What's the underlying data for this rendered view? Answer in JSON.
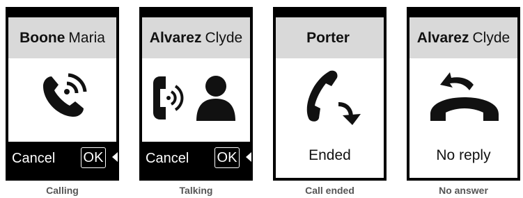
{
  "screens": [
    {
      "last_name": "Boone",
      "first_name": "Maria",
      "cancel_label": "Cancel",
      "ok_label": "OK",
      "caption": "Calling",
      "icon": "phone-calling-icon"
    },
    {
      "last_name": "Alvarez",
      "first_name": "Clyde",
      "cancel_label": "Cancel",
      "ok_label": "OK",
      "caption": "Talking",
      "icon": "phone-talking-icon"
    },
    {
      "last_name": "Porter",
      "first_name": "",
      "status": "Ended",
      "caption": "Call ended",
      "icon": "call-ended-icon"
    },
    {
      "last_name": "Alvarez",
      "first_name": "Clyde",
      "status": "No reply",
      "caption": "No answer",
      "icon": "no-answer-icon"
    }
  ]
}
